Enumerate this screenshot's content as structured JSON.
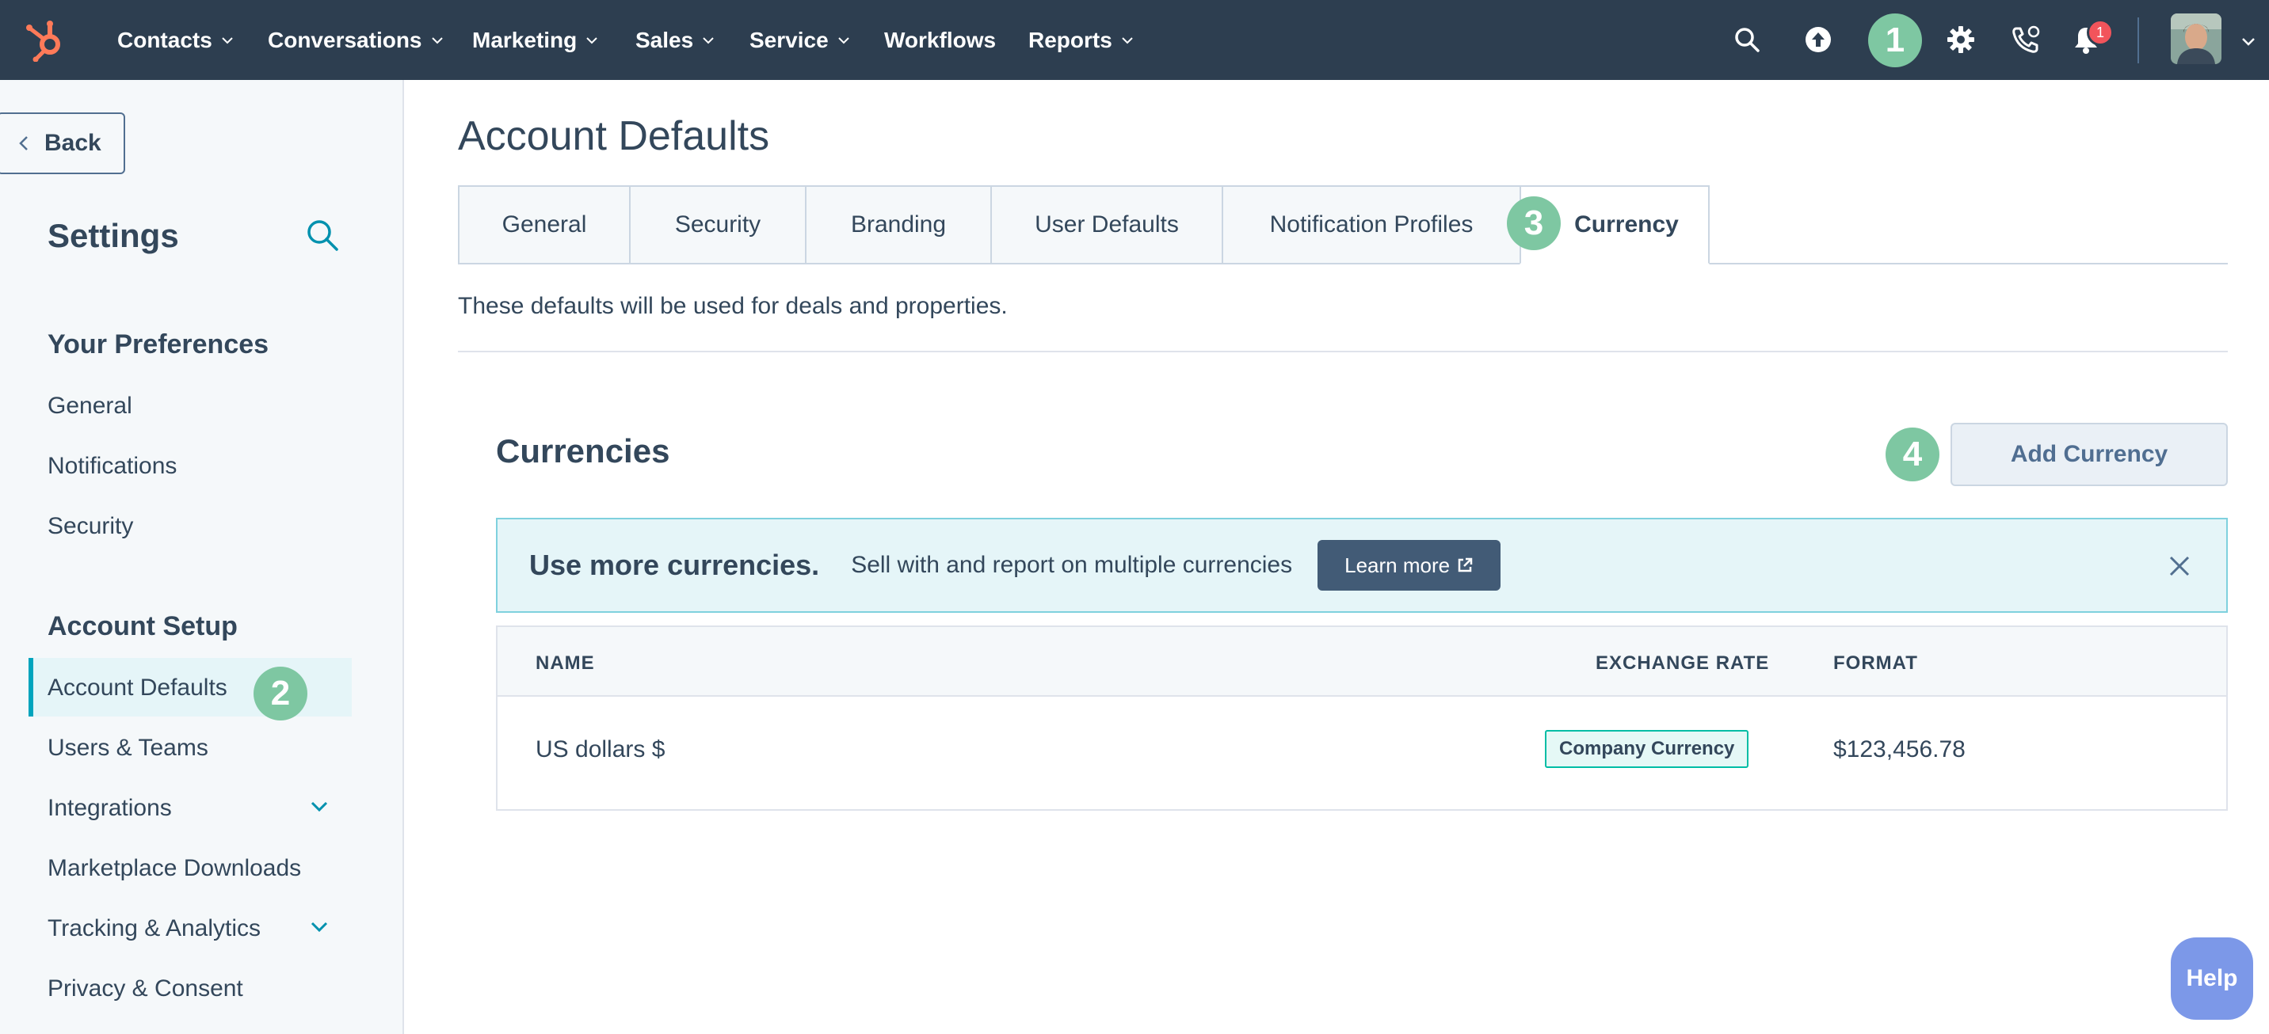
{
  "nav": {
    "items": [
      {
        "label": "Contacts",
        "dropdown": true
      },
      {
        "label": "Conversations",
        "dropdown": true
      },
      {
        "label": "Marketing",
        "dropdown": true
      },
      {
        "label": "Sales",
        "dropdown": true
      },
      {
        "label": "Service",
        "dropdown": true
      },
      {
        "label": "Workflows",
        "dropdown": false
      },
      {
        "label": "Reports",
        "dropdown": true
      }
    ],
    "icons": [
      "search-icon",
      "upgrade-icon",
      "settings-icon",
      "calling-icon",
      "notifications-icon"
    ],
    "notification_count": "1"
  },
  "steps": {
    "one": "1",
    "two": "2",
    "three": "3",
    "four": "4"
  },
  "sidebar": {
    "back_label": "Back",
    "title": "Settings",
    "sections": [
      {
        "title": "Your Preferences",
        "items": [
          "General",
          "Notifications",
          "Security"
        ]
      },
      {
        "title": "Account Setup",
        "items": [
          "Account Defaults",
          "Users & Teams",
          "Integrations",
          "Marketplace Downloads",
          "Tracking & Analytics",
          "Privacy & Consent"
        ]
      }
    ],
    "active_item": "Account Defaults"
  },
  "main": {
    "title": "Account Defaults",
    "tabs": [
      "General",
      "Security",
      "Branding",
      "User Defaults",
      "Notification Profiles",
      "Currency"
    ],
    "active_tab": "Currency",
    "description": "These defaults will be used for deals and properties.",
    "currencies_title": "Currencies",
    "add_button": "Add Currency",
    "banner": {
      "title": "Use more currencies.",
      "text": "Sell with and report on multiple currencies",
      "button": "Learn more"
    },
    "table": {
      "columns": [
        "NAME",
        "EXCHANGE RATE",
        "FORMAT"
      ],
      "rows": [
        {
          "name": "US dollars $",
          "exchange_rate": "Company Currency",
          "format": "$123,456.78"
        }
      ]
    }
  },
  "help_label": "Help",
  "colors": {
    "nav_bg": "#2d3e50",
    "accent": "#00a4bd",
    "step_marker": "#7ec7a2",
    "hubspot_orange": "#ff7a59",
    "banner_bg": "#e5f5f8"
  }
}
